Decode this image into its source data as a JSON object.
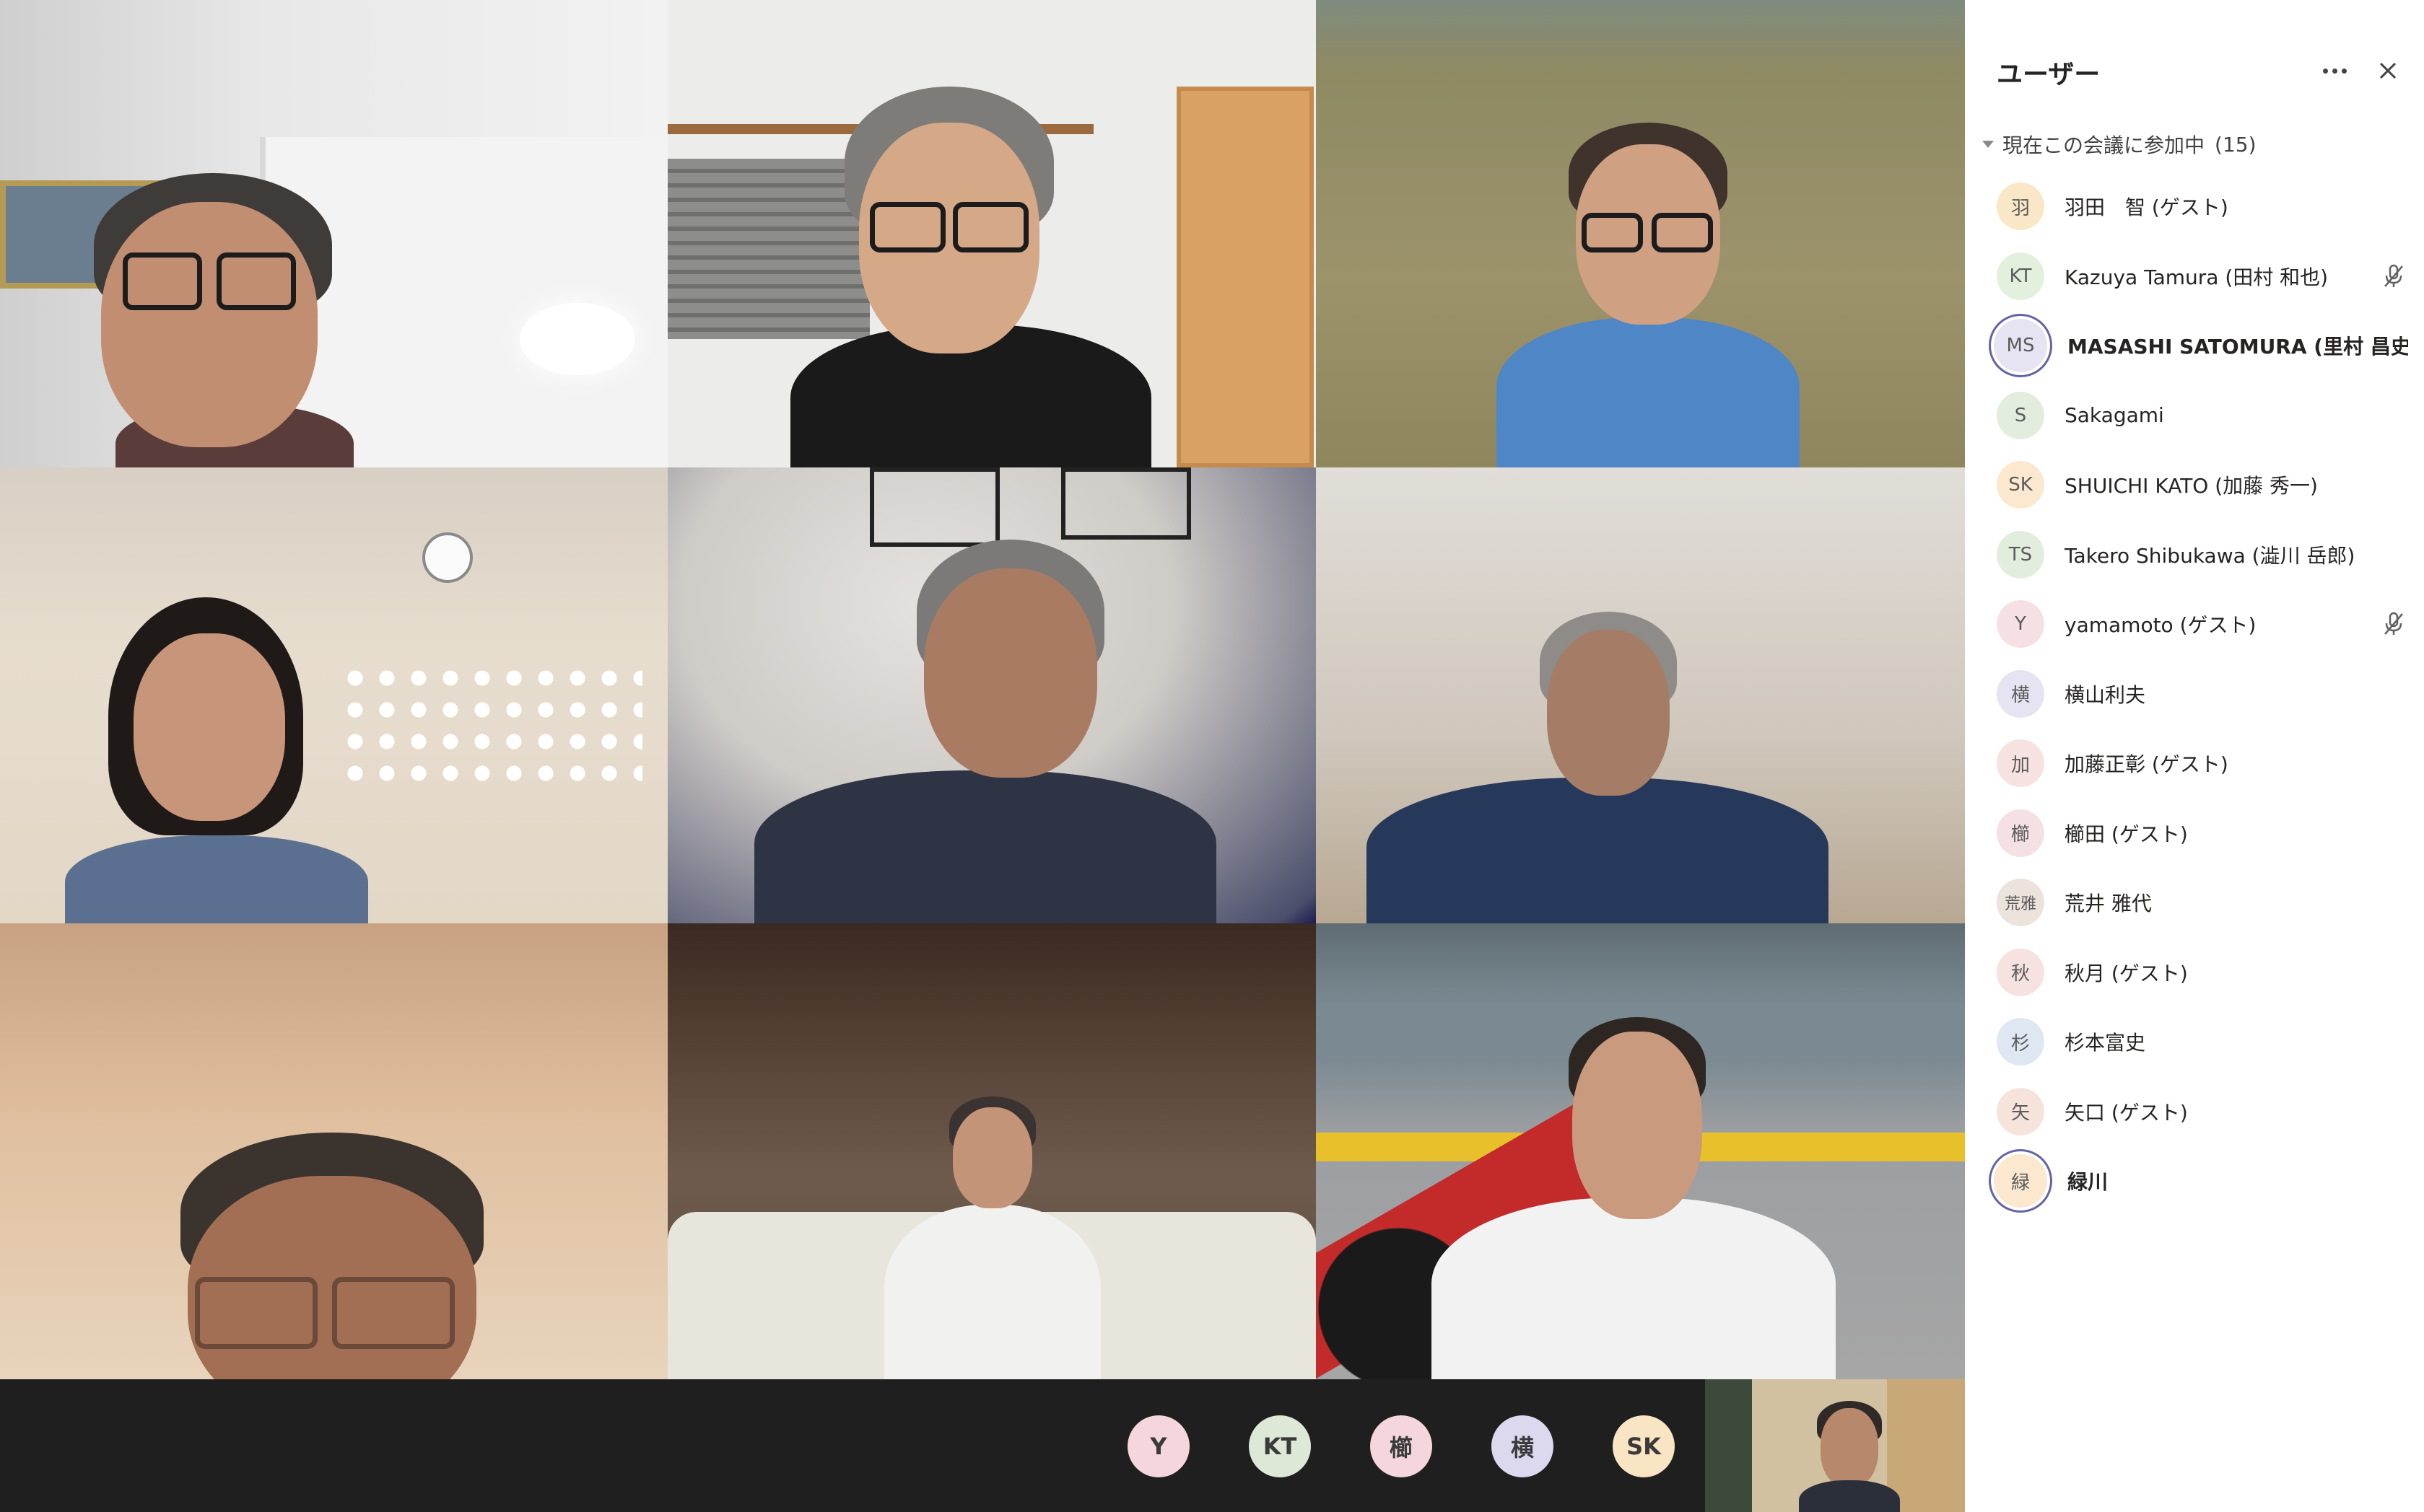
{
  "panel": {
    "title": "ユーザー",
    "more_icon": "more-icon",
    "close_icon": "close-icon",
    "section_label": "現在この会議に参加中",
    "section_count": "(15)",
    "participants": [
      {
        "initials": "羽",
        "name": "羽田　智 (ゲスト)",
        "avatar_color": "#f9e7c7",
        "muted": false,
        "bold": false
      },
      {
        "initials": "KT",
        "name": "Kazuya Tamura (田村 和也)",
        "avatar_color": "#e3f0dd",
        "muted": true,
        "bold": false
      },
      {
        "initials": "MS",
        "name": "MASASHI SATOMURA (里村 昌史)",
        "avatar_color": "#e6e3f3",
        "muted": false,
        "bold": true
      },
      {
        "initials": "S",
        "name": "Sakagami",
        "avatar_color": "#e2eddd",
        "muted": false,
        "bold": false
      },
      {
        "initials": "SK",
        "name": "SHUICHI KATO (加藤 秀一)",
        "avatar_color": "#fbe8cf",
        "muted": false,
        "bold": false
      },
      {
        "initials": "TS",
        "name": "Takero Shibukawa (澁川 岳郎)",
        "avatar_color": "#e2eddd",
        "muted": false,
        "bold": false
      },
      {
        "initials": "Y",
        "name": "yamamoto (ゲスト)",
        "avatar_color": "#f5e1e4",
        "muted": true,
        "bold": false
      },
      {
        "initials": "横",
        "name": "横山利夫",
        "avatar_color": "#e6e3f3",
        "muted": false,
        "bold": false
      },
      {
        "initials": "加",
        "name": "加藤正彰 (ゲスト)",
        "avatar_color": "#f6e2e0",
        "muted": false,
        "bold": false
      },
      {
        "initials": "櫛",
        "name": "櫛田 (ゲスト)",
        "avatar_color": "#f5e1e4",
        "muted": false,
        "bold": false
      },
      {
        "initials": "荒雅",
        "name": "荒井 雅代",
        "avatar_color": "#ede3dd",
        "muted": false,
        "bold": false
      },
      {
        "initials": "秋",
        "name": "秋月 (ゲスト)",
        "avatar_color": "#f6e2e0",
        "muted": false,
        "bold": false
      },
      {
        "initials": "杉",
        "name": "杉本富史",
        "avatar_color": "#dfe7f3",
        "muted": false,
        "bold": false
      },
      {
        "initials": "矢",
        "name": "矢口 (ゲスト)",
        "avatar_color": "#f6e4dc",
        "muted": false,
        "bold": false
      },
      {
        "initials": "緑",
        "name": "緑川",
        "avatar_color": "#fbe8cf",
        "muted": false,
        "bold": true
      }
    ]
  },
  "overflow": [
    {
      "initials": "Y",
      "color": "#f5d6dc"
    },
    {
      "initials": "KT",
      "color": "#dde9d6"
    },
    {
      "initials": "櫛",
      "color": "#f5d6dc"
    },
    {
      "initials": "横",
      "color": "#dcd9ef"
    },
    {
      "initials": "SK",
      "color": "#f9e4c4"
    }
  ]
}
